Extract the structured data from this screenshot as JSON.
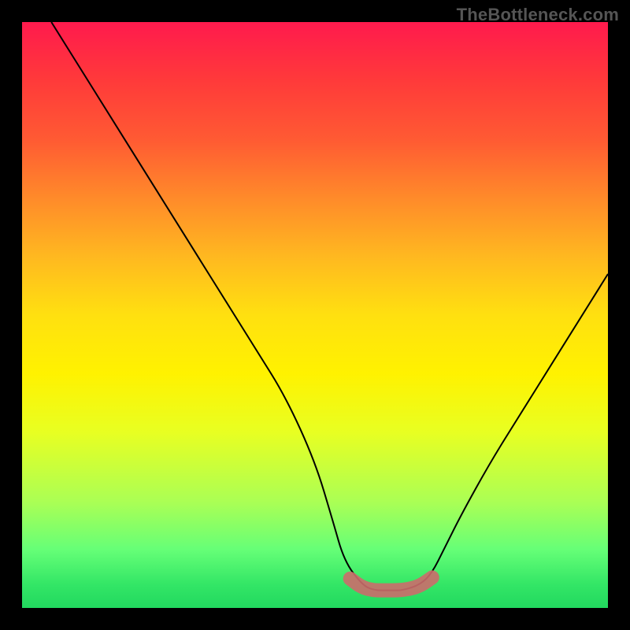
{
  "watermark": "TheBottleneck.com",
  "chart_data": {
    "type": "line",
    "title": "",
    "xlabel": "",
    "ylabel": "",
    "xlim": [
      0,
      100
    ],
    "ylim": [
      0,
      100
    ],
    "grid": false,
    "legend": false,
    "description": "V-shaped bottleneck curve over a vertical red-to-green heatmap gradient (red=high bottleneck, green=low bottleneck).",
    "series": [
      {
        "name": "bottleneck-curve",
        "color": "#000000",
        "x": [
          5,
          10,
          15,
          20,
          25,
          30,
          35,
          40,
          45,
          50,
          53,
          55,
          58,
          60,
          63,
          65,
          68,
          70,
          72,
          75,
          80,
          85,
          90,
          95,
          100
        ],
        "y": [
          100,
          92,
          84,
          76,
          68,
          60,
          52,
          44,
          36,
          25,
          15,
          8,
          4,
          3,
          3,
          3,
          4,
          6,
          10,
          16,
          25,
          33,
          41,
          49,
          57
        ]
      },
      {
        "name": "optimal-range-marker",
        "color": "#cc6b6b",
        "x": [
          56,
          58,
          60,
          62,
          64,
          66,
          68,
          70
        ],
        "y": [
          5,
          3.5,
          3,
          3,
          3,
          3.2,
          3.8,
          5.2
        ]
      }
    ]
  }
}
